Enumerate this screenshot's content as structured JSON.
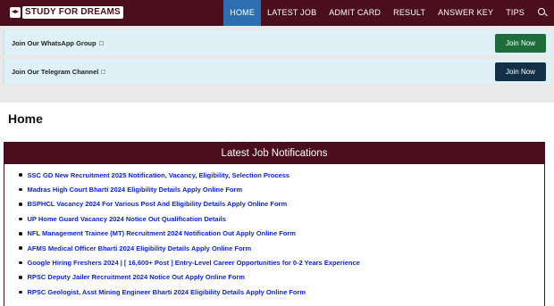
{
  "header": {
    "logo_text": "STUDY FOR DREAMS",
    "nav": [
      "HOME",
      "LATEST JOB",
      "ADMIT CARD",
      "RESULT",
      "ANSWER KEY",
      "TIPS"
    ],
    "active": "HOME",
    "search_icon": "search-icon",
    "colors": {
      "bar": "#4a0e1c",
      "active": "#2b6fb0"
    }
  },
  "join": [
    {
      "label": "Join Our WhatsApp Group",
      "button": "Join Now",
      "color": "#1f6d3a"
    },
    {
      "label": "Join Our Telegram Channel",
      "button": "Join Now",
      "color": "#143046"
    }
  ],
  "main": {
    "title": "Home",
    "box_title": "Latest Job Notifications",
    "jobs": [
      "SSC GD New Recruitment 2025 Notification, Vacancy, Eligibility, Selection Process",
      "Madras High Court Bharti 2024 Eligibility Details Apply Online Form",
      "BSPHCL Vacancy 2024 For Various Post And Eligibility Details Apply Online Form",
      "UP Home Guard Vacancy 2024 Notice Out Qualification Details",
      "NFL Management Trainee (MT) Recruitment 2024 Notification Out Apply Online Form",
      "AFMS Medical Officer Bharti 2024 Eligibility Details Apply Online Form",
      "Google Hiring Freshers 2024 | [ 16,600+ Post ] Entry-Level Career Opportunities for 0-2 Years Experience",
      "RPSC Deputy Jailer Recruitment 2024 Notice Out Apply Online Form",
      "RPSC Geologist, Asst Mining Engineer Bharti 2024 Eligibility Details Apply Online Form"
    ]
  }
}
